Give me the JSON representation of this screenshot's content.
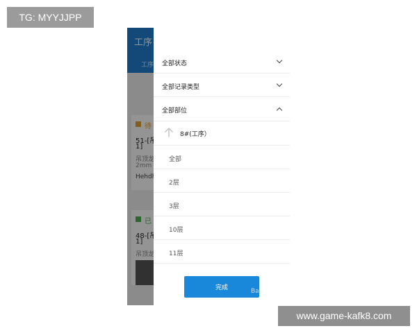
{
  "watermarks": {
    "top_left": "TG: MYYJJPP",
    "bottom_right": "www.game-kafk8.com"
  },
  "background_app": {
    "title": "工序",
    "tab": "工序",
    "cards": [
      {
        "status": "待",
        "status_color": "#e0a030",
        "line1": "51-[吊",
        "line2": "1]",
        "sub1": "吊顶龙",
        "sub2": "2mm",
        "sub3": "Hehdhe"
      },
      {
        "status": "已",
        "status_color": "#4caf50",
        "line1": "48-[吊",
        "line2": "1]",
        "sub1": "吊顶龙"
      }
    ]
  },
  "filter_panel": {
    "sections": [
      {
        "label": "全部状态",
        "expanded": false
      },
      {
        "label": "全部记录类型",
        "expanded": false
      },
      {
        "label": "全部部位",
        "expanded": true
      }
    ],
    "breadcrumb": "8#(工序）",
    "options": [
      "全部",
      "2层",
      "3层",
      "10层",
      "11层"
    ],
    "done_label": "完成"
  },
  "brand_mark": "Ba",
  "colors": {
    "header_blue": "#1f7fcf",
    "button_blue": "#1a88da"
  }
}
